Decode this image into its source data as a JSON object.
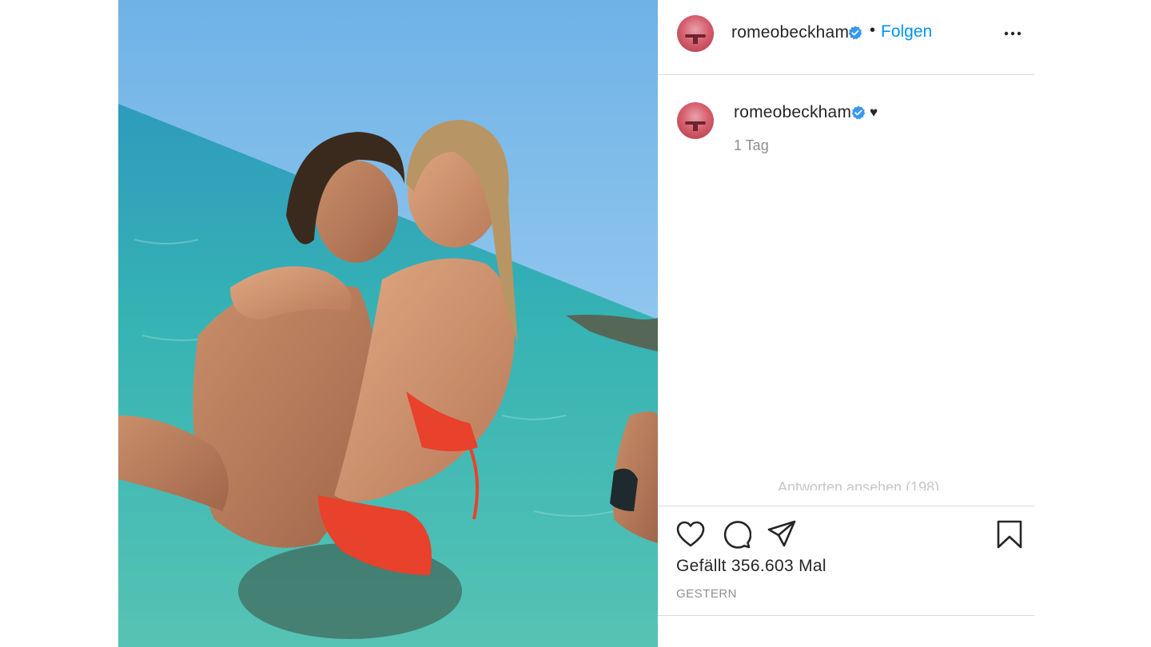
{
  "post": {
    "author": "romeobeckham",
    "verified": true,
    "follow_label": "Folgen",
    "separator": "•",
    "image_alt": "Paar umarmt sich im türkisfarbenen Meer"
  },
  "caption": {
    "author": "romeobeckham",
    "text": "♥",
    "time": "1 Tag"
  },
  "comments": {
    "replies_label": "Antworten ansehen (198)"
  },
  "footer": {
    "likes": "Gefällt 356.603 Mal",
    "date": "GESTERN"
  },
  "icons": {
    "header_more": "more-options-icon",
    "verified": "verified-badge-icon",
    "like": "heart-icon",
    "comment": "comment-icon",
    "share": "share-icon",
    "save": "bookmark-icon"
  },
  "colors": {
    "link_blue": "#0095f6",
    "verified_blue": "#3897f0",
    "divider": "#dbdbdb",
    "muted_text": "#8e8e8e"
  }
}
